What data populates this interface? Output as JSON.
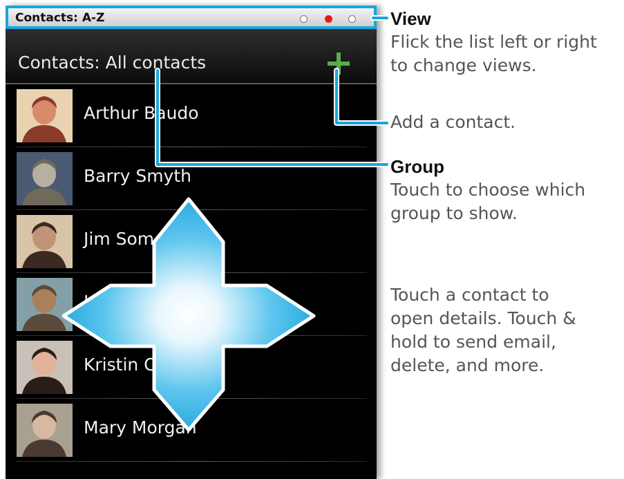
{
  "status_bar": {
    "title": "Contacts: A-Z",
    "indicator_dots": [
      "empty",
      "active",
      "empty"
    ],
    "active_color": "#e5191c",
    "highlight_color": "#17a7de"
  },
  "header": {
    "title": "Contacts: All contacts",
    "add_icon": "plus-icon",
    "add_icon_color": "#55b047"
  },
  "contacts": [
    {
      "name": "Arthur Baudo",
      "photo": "contact-photo-icon"
    },
    {
      "name": "Barry Smyth",
      "photo": "contact-photo-icon"
    },
    {
      "name": "Jim Somers",
      "photo": "contact-photo-icon"
    },
    {
      "name": "Juanita Leyva",
      "photo": "contact-photo-icon"
    },
    {
      "name": "Kristin Carter",
      "photo": "contact-photo-icon"
    },
    {
      "name": "Mary Morgan",
      "photo": "contact-photo-icon"
    }
  ],
  "navigation_overlay": {
    "icon": "four-way-arrow-icon"
  },
  "annotations": {
    "view": {
      "title": "View",
      "lines": [
        "Flick the list left or right",
        "to change views."
      ]
    },
    "add": {
      "lines": [
        "Add a contact."
      ]
    },
    "group": {
      "title": "Group",
      "lines": [
        "Touch to choose which",
        "group to show."
      ]
    },
    "contact": {
      "lines": [
        "Touch a contact to",
        "open details. Touch &",
        "hold to send email,",
        "delete, and more."
      ]
    }
  }
}
